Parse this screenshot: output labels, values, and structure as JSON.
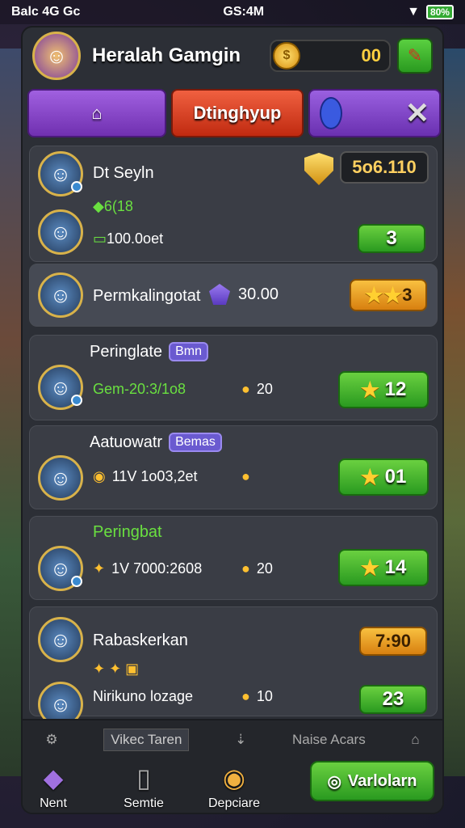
{
  "status": {
    "left": "Balc 4G  Gc",
    "time": "GS:4M",
    "battery": "80%"
  },
  "header": {
    "title": "Heralah Gamgin",
    "coins": "00"
  },
  "tabs": {
    "main": "Dtinghyup"
  },
  "rows": [
    {
      "name": "Dt Seyln",
      "sub1": "6(18",
      "sub2": "100.0oet",
      "score": "5o6.110",
      "btn": "3"
    },
    {
      "name": "Permkalingotat",
      "value": "30.00",
      "btn": "3"
    },
    {
      "name": "Peringlate",
      "badge": "Bmn",
      "sub": "Gem-20:3/1o8",
      "pin": "20",
      "btn": "12"
    },
    {
      "name": "Aatuowatr",
      "badge": "Bemas",
      "sub": "11V 1o03,2et",
      "pin": "",
      "btn": "01"
    },
    {
      "name": "Peringbat",
      "sub": "1V 7000:2608",
      "pin": "20",
      "btn": "14"
    },
    {
      "name": "Rabaskerkan",
      "timer": "7:90",
      "sub": "Nirikuno lozage",
      "pin": "10",
      "btn": "23"
    }
  ],
  "bottom": {
    "label1": "Vikec Taren",
    "label2": "Naise Acars",
    "nav1": "Nent",
    "nav2": "Semtie",
    "nav3": "Depciare",
    "cta": "Varlolarn"
  }
}
